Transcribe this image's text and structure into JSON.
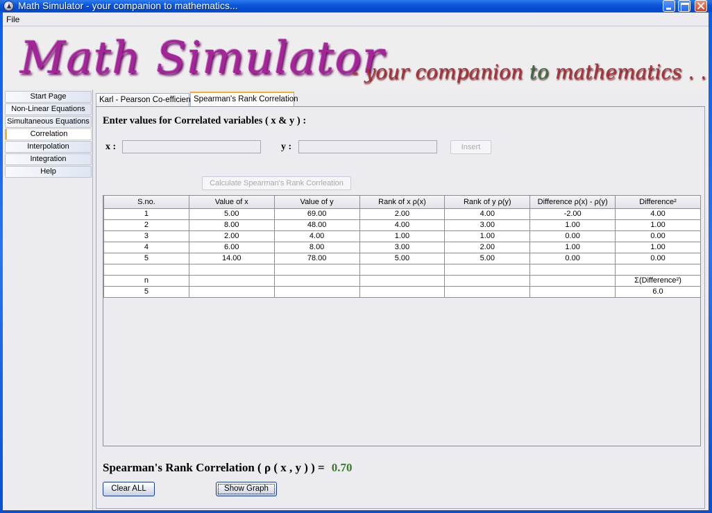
{
  "window": {
    "title": "Math Simulator - your companion to mathematics...",
    "icon": "app-logo-icon"
  },
  "menu": {
    "items": [
      "File"
    ]
  },
  "banner": {
    "title": "Math Simulator",
    "tagline_prefix": "- your companion ",
    "tagline_accent": "to",
    "tagline_rest": " mathematics . . ."
  },
  "sidebar": {
    "items": [
      {
        "label": "Start Page",
        "active": false
      },
      {
        "label": "Non-Linear Equations",
        "active": false
      },
      {
        "label": "Simultaneous Equations",
        "active": false
      },
      {
        "label": "Correlation",
        "active": true
      },
      {
        "label": "Interpolation",
        "active": false
      },
      {
        "label": "Integration",
        "active": false
      },
      {
        "label": "Help",
        "active": false
      }
    ]
  },
  "tabs": [
    {
      "label": "Karl - Pearson Co-efficient",
      "active": false
    },
    {
      "label": "Spearman's Rank Correlation",
      "active": true
    }
  ],
  "form": {
    "heading": "Enter values for Correlated variables ( x & y ) :",
    "x_label": "x :",
    "y_label": "y :",
    "x_value": "",
    "y_value": "",
    "insert_label": "Insert",
    "calculate_label": "Calculate Spearman's Rank Corrleation"
  },
  "table": {
    "headers": [
      "S.no.",
      "Value of x",
      "Value of y",
      "Rank of x  ρ(x)",
      "Rank of y  ρ(y)",
      "Difference  ρ(x) - ρ(y)",
      "Difference²"
    ],
    "rows": [
      [
        "1",
        "5.00",
        "69.00",
        "2.00",
        "4.00",
        "-2.00",
        "4.00"
      ],
      [
        "2",
        "8.00",
        "48.00",
        "4.00",
        "3.00",
        "1.00",
        "1.00"
      ],
      [
        "3",
        "2.00",
        "4.00",
        "1.00",
        "1.00",
        "0.00",
        "0.00"
      ],
      [
        "4",
        "6.00",
        "8.00",
        "3.00",
        "2.00",
        "1.00",
        "1.00"
      ],
      [
        "5",
        "14.00",
        "78.00",
        "5.00",
        "5.00",
        "0.00",
        "0.00"
      ],
      [
        "",
        "",
        "",
        "",
        "",
        "",
        ""
      ],
      [
        "n",
        "",
        "",
        "",
        "",
        "",
        "Σ(Difference²)"
      ],
      [
        "5",
        "",
        "",
        "",
        "",
        "",
        "6.0"
      ]
    ]
  },
  "result": {
    "label": "Spearman's Rank Correlation ( ρ ( x , y ) ) =",
    "value": "0.70",
    "value_color": "#3a7a2a"
  },
  "buttons": {
    "clear_label": "Clear ALL",
    "graph_label": "Show Graph"
  }
}
